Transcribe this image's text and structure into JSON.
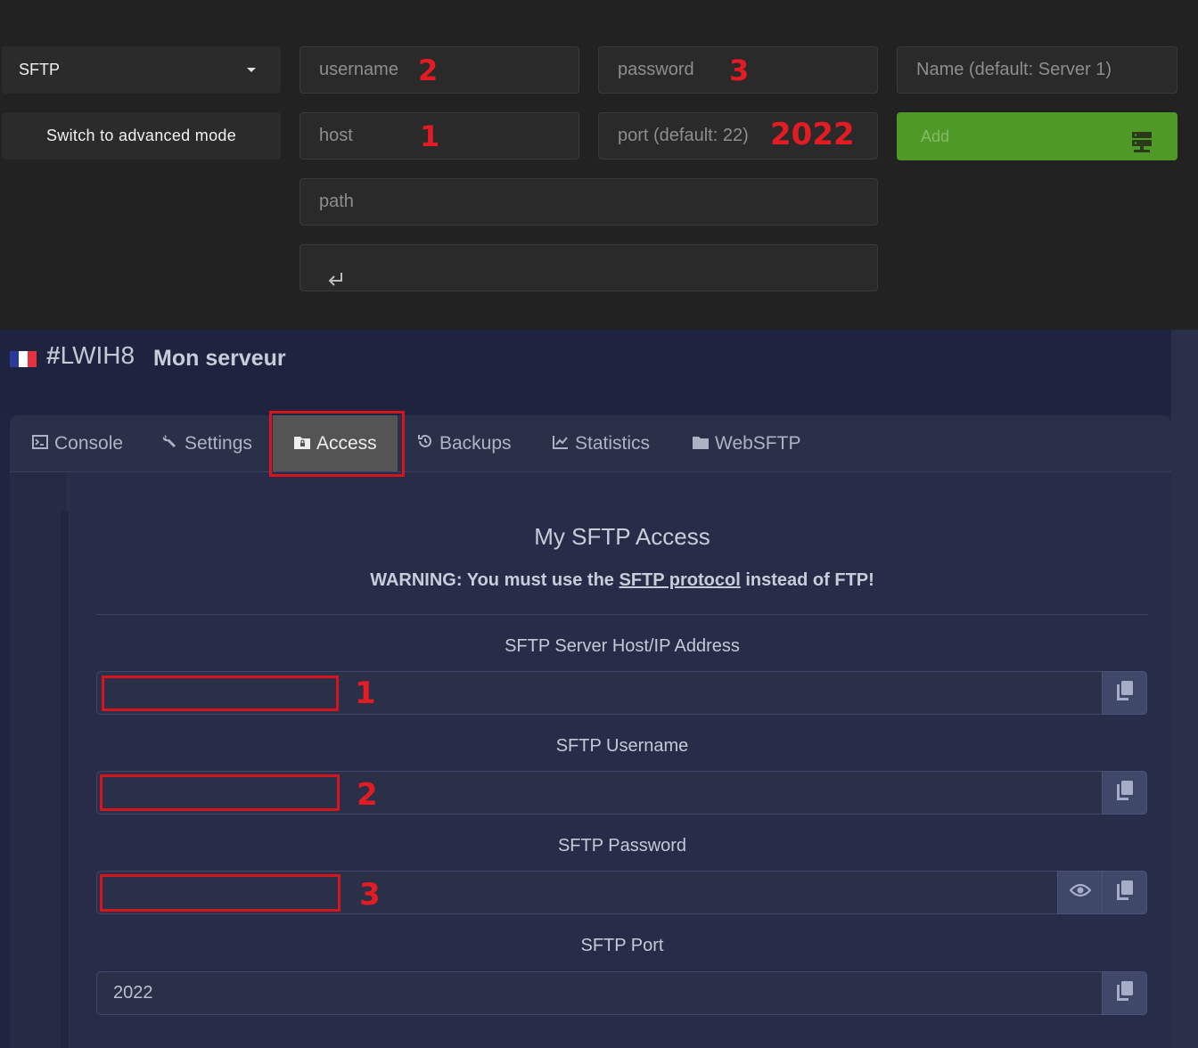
{
  "top_panel": {
    "protocol_select": "SFTP",
    "advanced_mode_button": "Switch to advanced mode",
    "username_placeholder": "username",
    "password_placeholder": "password",
    "name_placeholder": "Name (default: Server 1)",
    "host_placeholder": "host",
    "port_placeholder": "port (default: 22)",
    "path_placeholder": "path",
    "add_button": "Add",
    "annotations": {
      "host": "1",
      "username": "2",
      "password": "3",
      "port": "2022"
    }
  },
  "server": {
    "id_hash": "#",
    "id": "LWIH8",
    "name": "Mon serveur",
    "flag_colors": [
      "#2a3a9a",
      "#ffffff",
      "#e8313e"
    ]
  },
  "tabs": [
    {
      "label": "Console",
      "icon": "terminal-icon"
    },
    {
      "label": "Settings",
      "icon": "wrench-icon"
    },
    {
      "label": "Access",
      "icon": "folder-lock-icon",
      "active": true
    },
    {
      "label": "Backups",
      "icon": "history-icon"
    },
    {
      "label": "Statistics",
      "icon": "chart-line-icon"
    },
    {
      "label": "WebSFTP",
      "icon": "folder-icon"
    }
  ],
  "access": {
    "title": "My SFTP Access",
    "warning_prefix": "WARNING: You must use the ",
    "warning_link": "SFTP protocol",
    "warning_suffix": " instead of FTP!",
    "fields": {
      "host_label": "SFTP Server Host/IP Address",
      "username_label": "SFTP Username",
      "password_label": "SFTP Password",
      "port_label": "SFTP Port",
      "port_value": "2022"
    },
    "annotations": {
      "host": "1",
      "username": "2",
      "password": "3"
    }
  },
  "colors": {
    "highlight_red": "#d7141e",
    "add_green": "#4f9a27"
  }
}
